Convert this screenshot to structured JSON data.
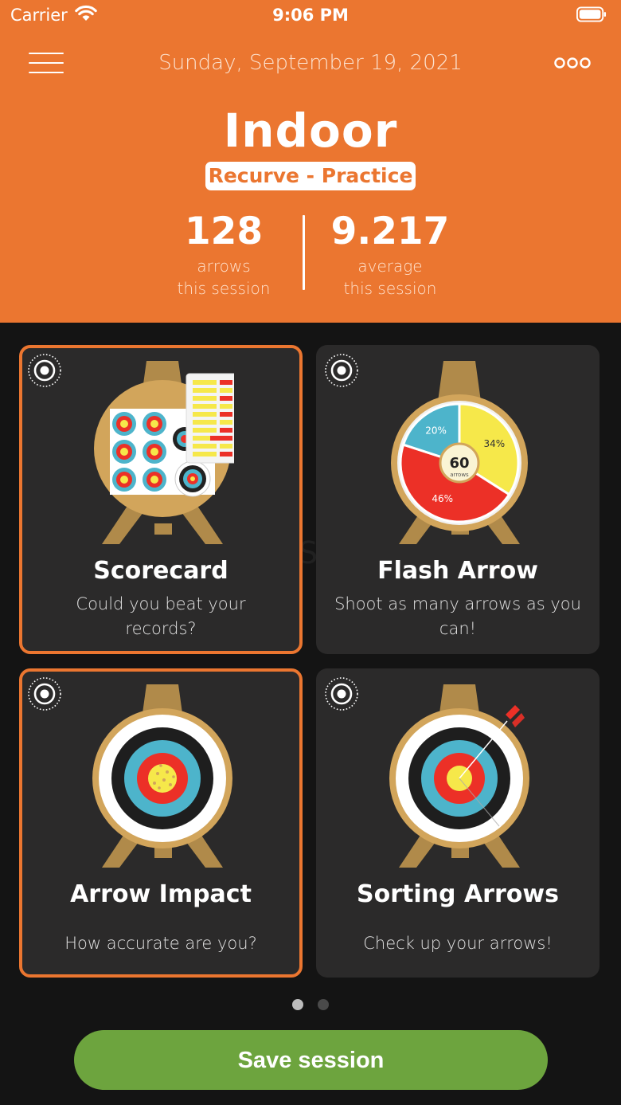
{
  "status_bar": {
    "carrier": "Carrier",
    "time": "9:06 PM"
  },
  "header": {
    "date": "Sunday, September 19, 2021",
    "title": "Indoor",
    "mode": "Recurve - Practice",
    "stats": [
      {
        "value": "128",
        "label_line1": "arrows",
        "label_line2": "this session"
      },
      {
        "value": "9.217",
        "label_line1": "average",
        "label_line2": "this session"
      }
    ]
  },
  "cards": [
    {
      "title": "Scorecard",
      "desc": "Could you beat your records?",
      "selected": true
    },
    {
      "title": "Flash Arrow",
      "desc": "Shoot as many arrows as you can!",
      "selected": false,
      "pie": {
        "center_value": "60",
        "center_label": "arrows",
        "slices": [
          {
            "label": "34%",
            "value": 34,
            "color": "#F6E84A"
          },
          {
            "label": "46%",
            "value": 46,
            "color": "#EC3027"
          },
          {
            "label": "20%",
            "value": 20,
            "color": "#4DB4CB"
          }
        ]
      }
    },
    {
      "title": "Arrow Impact",
      "desc": "How accurate are you?",
      "selected": true
    },
    {
      "title": "Sorting Arrows",
      "desc": "Check up your arrows!",
      "selected": false
    }
  ],
  "pagination": {
    "pages": 2,
    "current": 1
  },
  "save_button": "Save session",
  "watermark": "UpdateStar.com",
  "colors": {
    "accent": "#EB7630",
    "save": "#6DA43E",
    "card_bg": "#2B2A2A",
    "background": "#141414"
  }
}
